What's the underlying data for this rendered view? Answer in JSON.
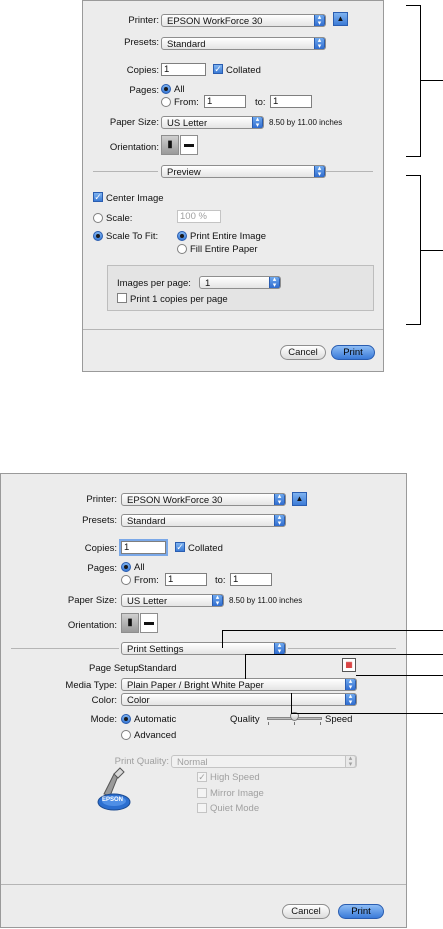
{
  "dialog1": {
    "printer_label": "Printer:",
    "printer_value": "EPSON WorkForce 30",
    "presets_label": "Presets:",
    "presets_value": "Standard",
    "copies_label": "Copies:",
    "copies_value": "1",
    "collated_label": "Collated",
    "pages_label": "Pages:",
    "all_label": "All",
    "from_label": "From:",
    "from_value": "1",
    "to_label": "to:",
    "to_value": "1",
    "paper_size_label": "Paper Size:",
    "paper_size_value": "US Letter",
    "paper_size_dims": "8.50 by 11.00 inches",
    "orientation_label": "Orientation:",
    "section_value": "Preview",
    "center_image_label": "Center Image",
    "scale_label": "Scale:",
    "scale_value": "100 %",
    "scale_to_fit_label": "Scale To Fit:",
    "print_entire_image_label": "Print Entire Image",
    "fill_entire_paper_label": "Fill Entire Paper",
    "images_per_page_label": "Images per page:",
    "images_per_page_value": "1",
    "print_copies_label": "Print 1 copies per page",
    "cancel_label": "Cancel",
    "print_label": "Print"
  },
  "dialog2": {
    "printer_label": "Printer:",
    "printer_value": "EPSON WorkForce 30",
    "presets_label": "Presets:",
    "presets_value": "Standard",
    "copies_label": "Copies:",
    "copies_value": "1",
    "collated_label": "Collated",
    "pages_label": "Pages:",
    "all_label": "All",
    "from_label": "From:",
    "from_value": "1",
    "to_label": "to:",
    "to_value": "1",
    "paper_size_label": "Paper Size:",
    "paper_size_value": "US Letter",
    "paper_size_dims": "8.50 by 11.00 inches",
    "orientation_label": "Orientation:",
    "section_value": "Print Settings",
    "page_setup_label": "Page Setup:",
    "page_setup_value": "Standard",
    "media_type_label": "Media Type:",
    "media_type_value": "Plain Paper / Bright White Paper",
    "color_label": "Color:",
    "color_value": "Color",
    "mode_label": "Mode:",
    "automatic_label": "Automatic",
    "advanced_label": "Advanced",
    "quality_label": "Quality",
    "speed_label": "Speed",
    "quality_speed_position": 0.5,
    "print_quality_label": "Print Quality:",
    "print_quality_value": "Normal",
    "high_speed_label": "High Speed",
    "mirror_image_label": "Mirror Image",
    "quiet_mode_label": "Quiet Mode",
    "epson_logo_text": "EPSON",
    "cancel_label": "Cancel",
    "print_label": "Print"
  },
  "icons": {
    "popup_arrows": "updown-chevron-icon",
    "disclosure": "triangle-up-icon",
    "portrait": "portrait-orientation-icon",
    "landscape": "landscape-orientation-icon",
    "page_setup": "printer-settings-icon",
    "epson_logo": "epson-printer-logo-icon"
  },
  "colors": {
    "accent": "#3c7bd6",
    "panel_bg": "#ececec"
  }
}
